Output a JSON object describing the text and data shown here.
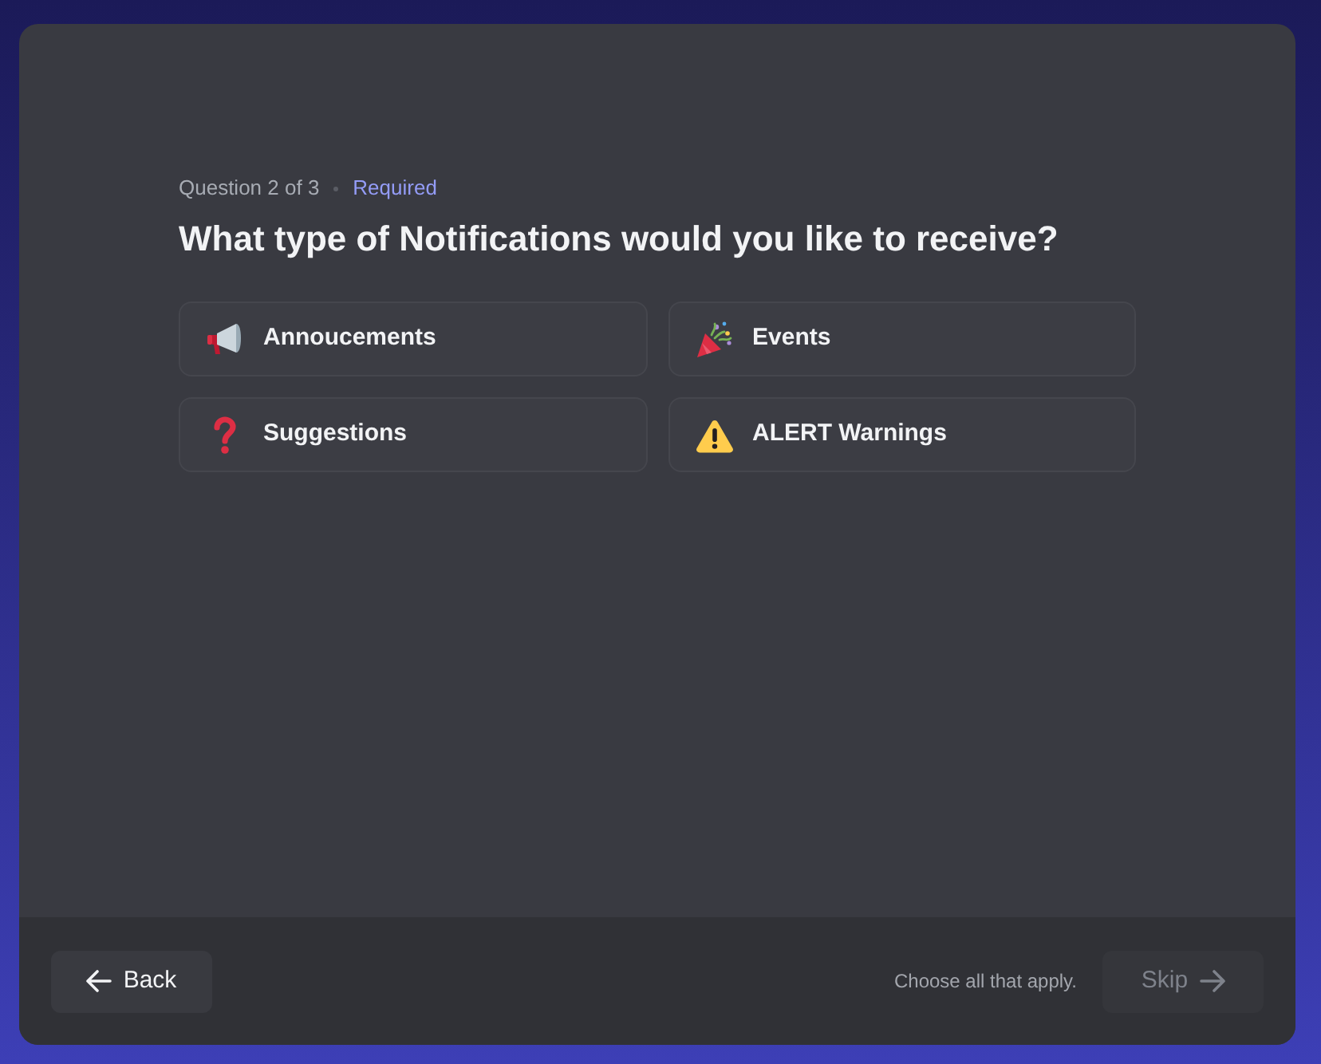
{
  "progress": {
    "label": "Question 2 of 3",
    "required_label": "Required"
  },
  "question": "What type of Notifications would you like to receive?",
  "options": [
    {
      "label": "Annoucements",
      "selected": false
    },
    {
      "label": "Events",
      "selected": false
    },
    {
      "label": "Suggestions",
      "selected": false
    },
    {
      "label": "ALERT Warnings",
      "selected": false
    }
  ],
  "footer": {
    "back_button": "Back",
    "hint": "Choose all that apply.",
    "skip_button": {
      "label": "Skip",
      "disabled": true
    }
  }
}
